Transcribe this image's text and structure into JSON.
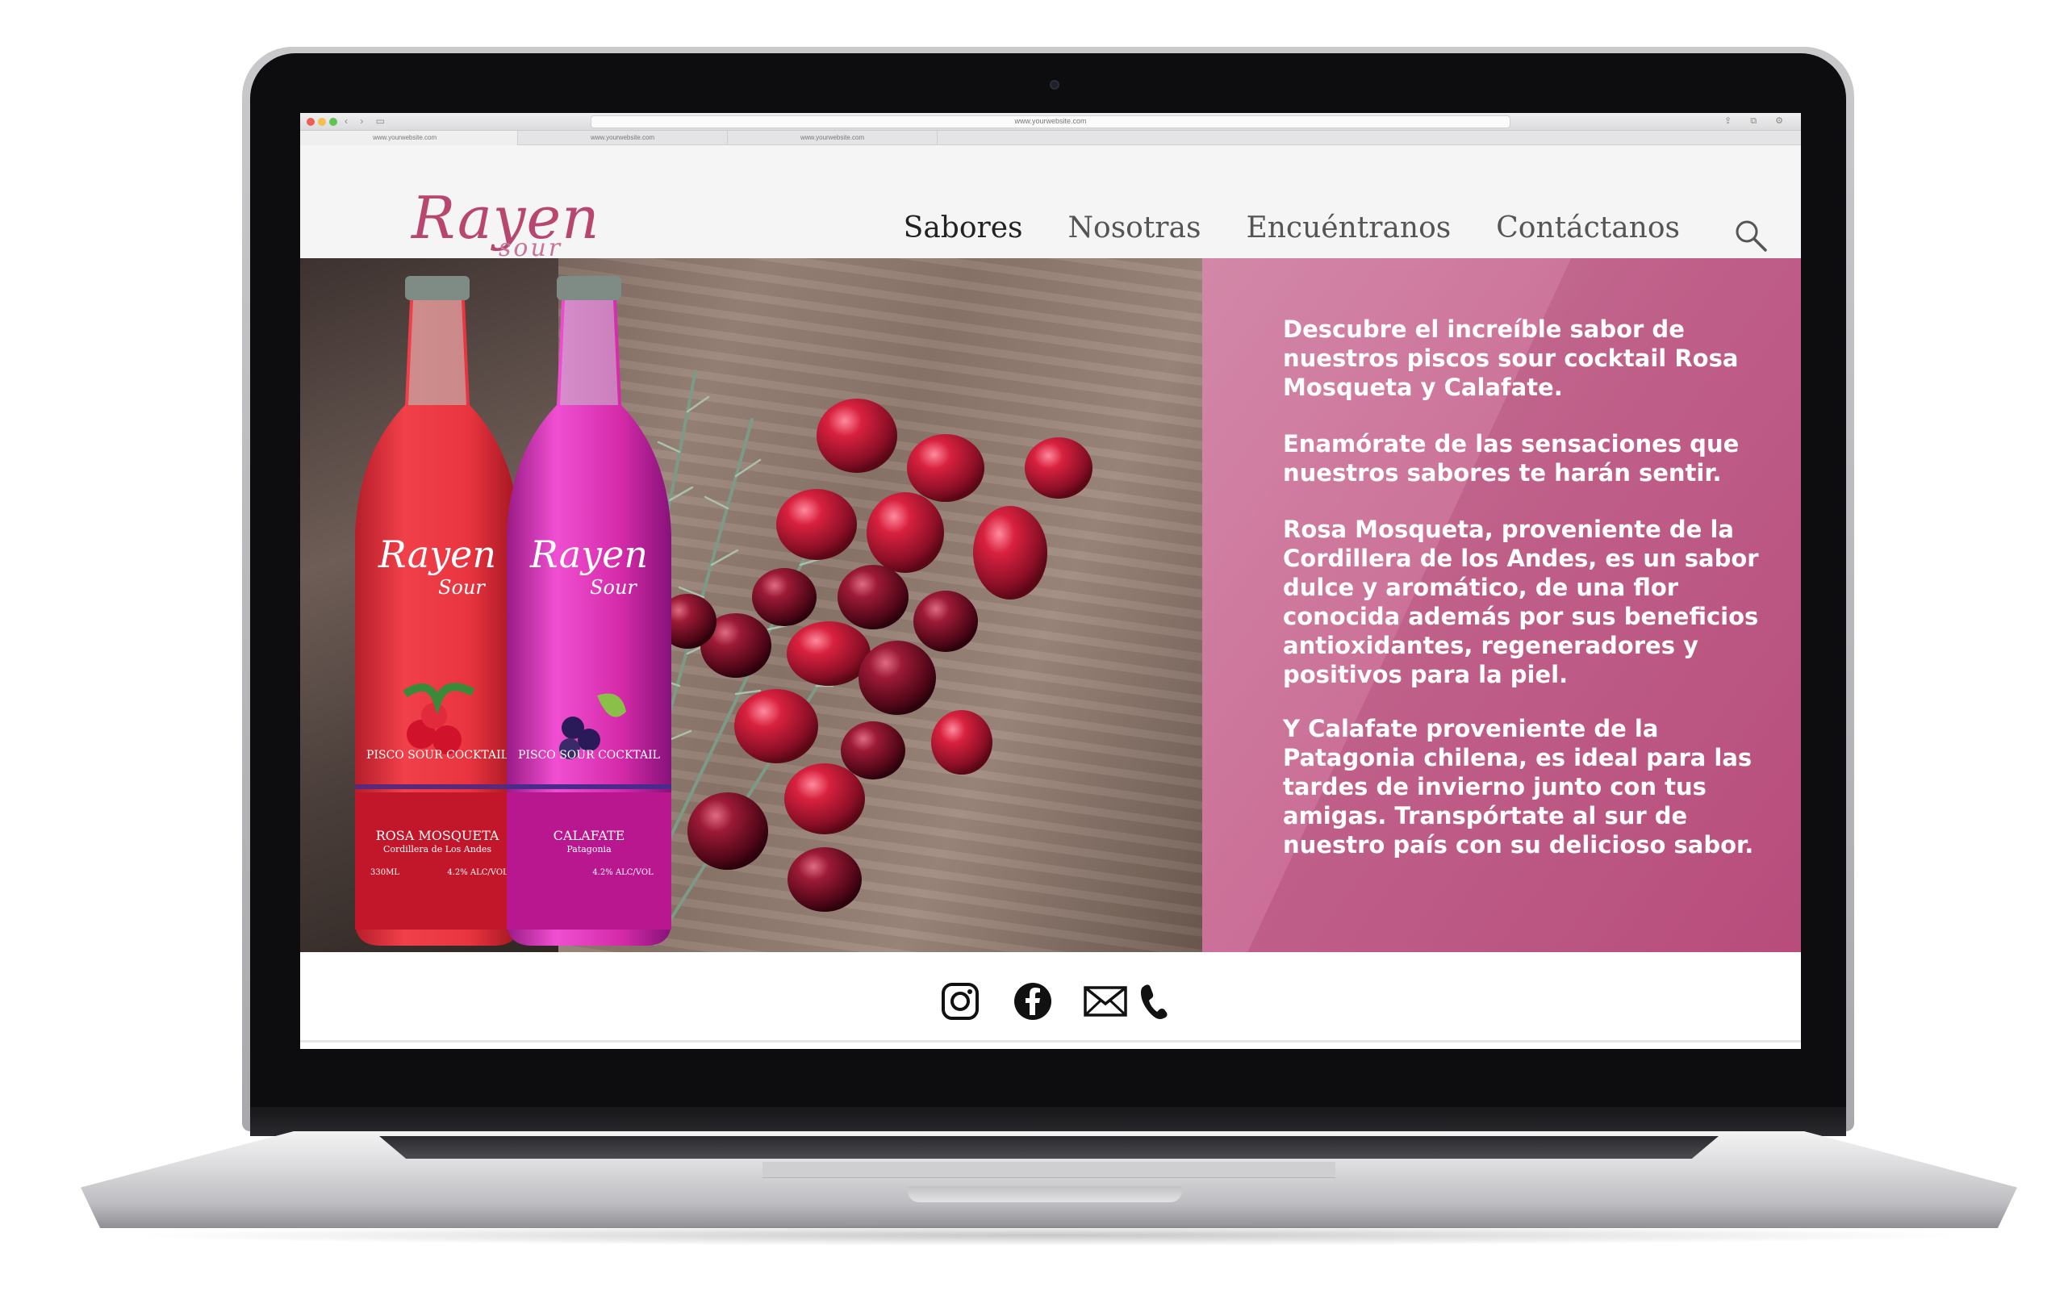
{
  "browser": {
    "url": "www.yourwebsite.com",
    "tabs": [
      "www.yourwebsite.com",
      "www.yourwebsite.com",
      "www.yourwebsite.com"
    ]
  },
  "brand": {
    "name": "Rayen",
    "tagline": "sour",
    "color": "#b8476f"
  },
  "nav": {
    "items": [
      {
        "label": "Sabores",
        "active": true
      },
      {
        "label": "Nosotras",
        "active": false
      },
      {
        "label": "Encuéntranos",
        "active": false
      },
      {
        "label": "Contáctanos",
        "active": false
      }
    ],
    "search_icon": "search-icon"
  },
  "hero": {
    "paragraphs": [
      "Descubre el increíble sabor de nuestros piscos sour cocktail Rosa Mosqueta y Calafate.",
      "Enamórate de las sensaciones que nuestros sabores te harán sentir.",
      "Rosa Mosqueta, proveniente de la Cordillera de los Andes, es un sabor dulce y aromático, de una flor conocida además por sus beneficios antioxidantes, regeneradores y positivos para la piel.",
      "Y Calafate proveniente de la Patagonia chilena, es ideal para las tardes de invierno junto con tus amigas. Transpórtate al sur de nuestro país con su delicioso sabor."
    ],
    "panel_color": "#c7648f",
    "bottles": [
      {
        "brand": "Rayen",
        "sub": "Sour",
        "type": "PISCO SOUR COCKTAIL",
        "flavor": "ROSA MOSQUETA",
        "origin": "Cordillera de Los Andes",
        "volume": "330ML",
        "abv": "4.2% ALC/VOL",
        "color": "#e8343f"
      },
      {
        "brand": "Rayen",
        "sub": "Sour",
        "type": "PISCO SOUR COCKTAIL",
        "flavor": "CALAFATE",
        "origin": "Patagonia",
        "abv": "4.2% ALC/VOL",
        "color": "#d42aa8"
      }
    ]
  },
  "footer": {
    "social": [
      "instagram-icon",
      "facebook-icon",
      "mail-icon",
      "phone-icon"
    ]
  }
}
